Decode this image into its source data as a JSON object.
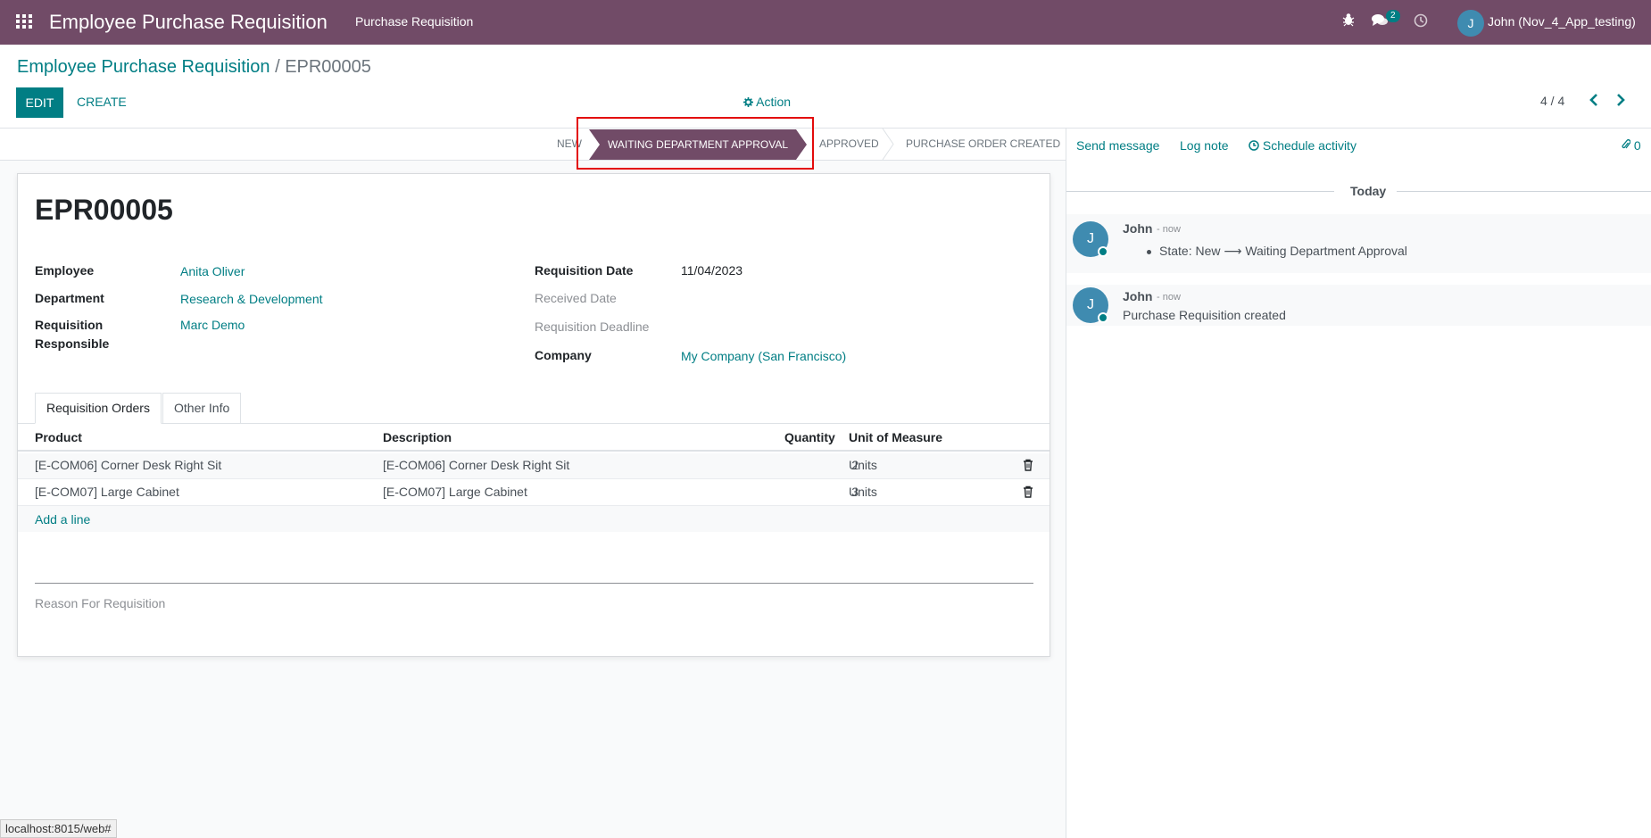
{
  "navbar": {
    "app_title": "Employee Purchase Requisition",
    "menu_item": "Purchase Requisition",
    "messages_badge": "2",
    "user_initial": "J",
    "user_name": "John (Nov_4_App_testing)",
    "bg_color": "#714b67"
  },
  "breadcrumb": {
    "parent": "Employee Purchase Requisition",
    "separator": "/",
    "current": "EPR00005"
  },
  "toolbar": {
    "edit_label": "EDIT",
    "create_label": "CREATE",
    "action_label": "Action",
    "pager": "4 / 4"
  },
  "statusbar": {
    "stages": [
      "NEW",
      "WAITING DEPARTMENT APPROVAL",
      "APPROVED",
      "PURCHASE ORDER CREATED"
    ],
    "active_stage": "WAITING DEPARTMENT APPROVAL"
  },
  "form": {
    "reference": "EPR00005",
    "left_fields": [
      {
        "label": "Employee",
        "value": "Anita Oliver"
      },
      {
        "label": "Department",
        "value": "Research & Development"
      },
      {
        "label": "Requisition Responsible",
        "value": "Marc Demo"
      }
    ],
    "right_fields": [
      {
        "label": "Requisition Date",
        "value": "11/04/2023"
      },
      {
        "label": "Received Date",
        "value": ""
      },
      {
        "label": "Requisition Deadline",
        "value": ""
      },
      {
        "label": "Company",
        "value": "My Company (San Francisco)"
      }
    ],
    "tabs": [
      "Requisition Orders",
      "Other Info"
    ],
    "table": {
      "columns": [
        "Product",
        "Description",
        "Quantity",
        "Unit of Measure"
      ],
      "rows": [
        {
          "product": "[E-COM06] Corner Desk Right Sit",
          "description": "[E-COM06] Corner Desk Right Sit",
          "quantity": "2",
          "uom": "Units"
        },
        {
          "product": "[E-COM07] Large Cabinet",
          "description": "[E-COM07] Large Cabinet",
          "quantity": "3",
          "uom": "Units"
        }
      ],
      "add_line": "Add a line"
    },
    "reason_placeholder": "Reason For Requisition"
  },
  "chatter": {
    "send_message": "Send message",
    "log_note": "Log note",
    "schedule_activity": "Schedule activity",
    "attachments_count": "0",
    "date_separator": "Today",
    "messages": [
      {
        "author": "John",
        "time": "- now",
        "initial": "J",
        "body": "State: New ⟶ Waiting Department Approval"
      },
      {
        "author": "John",
        "time": "- now",
        "initial": "J",
        "body": "Purchase Requisition created"
      }
    ]
  },
  "status_url": "localhost:8015/web#",
  "colors": {
    "accent": "#017e84",
    "primary": "#714b67",
    "highlight": "#e30b0b"
  }
}
